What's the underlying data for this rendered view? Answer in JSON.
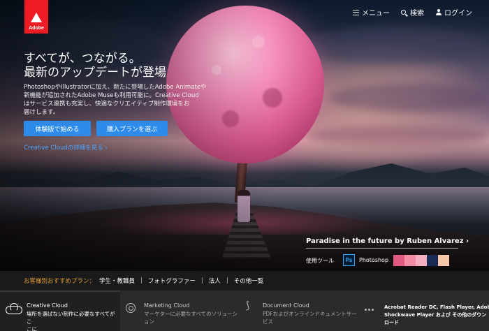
{
  "header": {
    "logo_text": "Adobe",
    "nav": {
      "menu": "メニュー",
      "search": "検索",
      "login": "ログイン"
    }
  },
  "hero": {
    "headline_line1": "すべてが、つながる。",
    "headline_line2": "最新のアップデートが登場",
    "body_line1": "PhotoshopやIllustratorに加え、新たに登場したAdobe Animateや",
    "body_line2": "新機能が追加されたAdobe Museも利用可能に。Creative Cloud",
    "body_line3": "はサービス連携も充実し、快適なクリエイティブ制作環境をお",
    "body_line4": "届けします。",
    "btn_trial": "体験版で始める",
    "btn_buy": "購入プランを選ぶ",
    "cc_link": "Creative Cloudの詳細を見る ›",
    "accent_color": "#2d8ceb"
  },
  "artwork": {
    "title": "Paradise in the future by Ruben Alvarez ›",
    "tools_label": "使用ツール",
    "tool_icon_text": "Ps",
    "tool_name": "Photoshop",
    "swatches": [
      "#e05a82",
      "#f28ca6",
      "#f4aec0",
      "#1a2a55",
      "#f7c6a8"
    ]
  },
  "recommend": {
    "label": "お客様別おすすめプラン：",
    "items": [
      "学生・教職員",
      "フォトグラファー",
      "法人",
      "その他一覧"
    ],
    "separator": "|"
  },
  "footer": {
    "creative_cloud": {
      "title": "Creative Cloud",
      "desc_line1": "場所を選ばない制作に必要なすべてがこ",
      "desc_line2": "こに"
    },
    "marketing_cloud": {
      "title": "Marketing Cloud",
      "desc_line1": "マーケターに必要なすべてのソリューション"
    },
    "document_cloud": {
      "title": "Document Cloud",
      "desc_line1": "PDFおよびオンラインドキュメントサービス"
    },
    "downloads": {
      "line1": "Acrobat Reader DC, Flash Player, Adobe AIR,",
      "line2": "Shockwave Player および その他のダウン",
      "line3": "ロード"
    }
  }
}
